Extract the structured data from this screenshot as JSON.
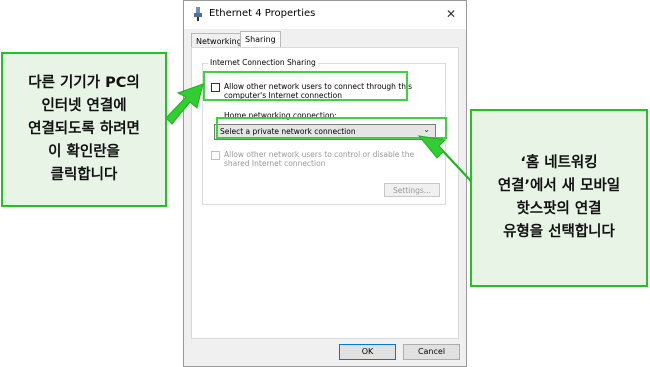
{
  "window": {
    "title": "Ethernet 4 Properties",
    "close_glyph": "✕"
  },
  "tabs": [
    {
      "label": "Networking"
    },
    {
      "label": "Sharing"
    }
  ],
  "ics": {
    "group_title": "Internet Connection Sharing",
    "allow_connect_label": "Allow other network users to connect through this computer's Internet connection",
    "home_connection_label": "Home networking connection:",
    "home_connection_value": "Select a private network connection",
    "allow_control_label": "Allow other network users to control or disable the shared Internet connection",
    "settings_label": "Settings..."
  },
  "buttons": {
    "ok": "OK",
    "cancel": "Cancel"
  },
  "callouts": {
    "left": "다른 기기가 PC의\n인터넷 연결에\n연결되도록 하려면\n이 확인란을\n클릭합니다",
    "right": "‘홈 네트워킹\n연결’에서 새 모바일\n핫스팟의 연결\n유형을 선택합니다"
  },
  "colors": {
    "highlight": "#3fd13f",
    "callout_border": "#22c222",
    "callout_fill": "#e8f5e6",
    "ok_border": "#0078d7"
  },
  "icons": {
    "window": "ethernet-adapter-icon",
    "dropdown": "chevron-down-icon"
  }
}
